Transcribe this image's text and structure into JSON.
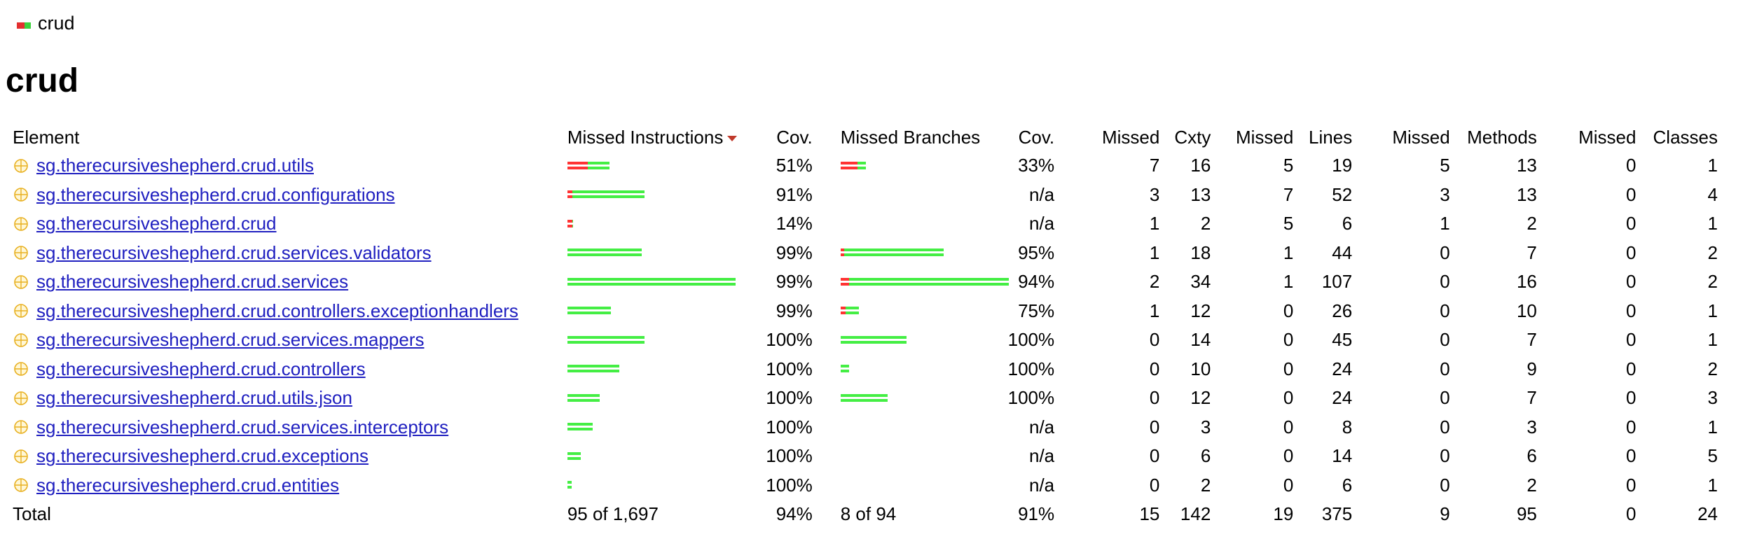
{
  "breadcrumb": {
    "label": "crud"
  },
  "page": {
    "title": "crud"
  },
  "table": {
    "headers": {
      "element": "Element",
      "missed_instructions": "Missed Instructions",
      "instr_cov": "Cov.",
      "missed_branches": "Missed Branches",
      "branch_cov": "Cov.",
      "missed_cxty": "Missed",
      "cxty": "Cxty",
      "missed_lines": "Missed",
      "lines": "Lines",
      "missed_methods": "Missed",
      "methods": "Methods",
      "missed_classes": "Missed",
      "classes": "Classes"
    },
    "rows": [
      {
        "name": "sg.therecursiveshepherd.crud.utils",
        "instr_cov": "51%",
        "branch_cov": "33%",
        "missed_cxty": "7",
        "cxty": "16",
        "missed_lines": "5",
        "lines": "19",
        "missed_methods": "5",
        "methods": "13",
        "missed_classes": "0",
        "classes": "1",
        "instr_bar": {
          "missed_fraction": 0.12,
          "covered_fraction": 0.13
        },
        "branch_bar": {
          "missed_fraction": 0.1,
          "covered_fraction": 0.05
        }
      },
      {
        "name": "sg.therecursiveshepherd.crud.configurations",
        "instr_cov": "91%",
        "branch_cov": "n/a",
        "missed_cxty": "3",
        "cxty": "13",
        "missed_lines": "7",
        "lines": "52",
        "missed_methods": "3",
        "methods": "13",
        "missed_classes": "0",
        "classes": "4",
        "instr_bar": {
          "missed_fraction": 0.03,
          "covered_fraction": 0.43
        },
        "branch_bar": null
      },
      {
        "name": "sg.therecursiveshepherd.crud",
        "instr_cov": "14%",
        "branch_cov": "n/a",
        "missed_cxty": "1",
        "cxty": "2",
        "missed_lines": "5",
        "lines": "6",
        "missed_methods": "1",
        "methods": "2",
        "missed_classes": "0",
        "classes": "1",
        "instr_bar": {
          "missed_fraction": 0.03,
          "covered_fraction": 0.005
        },
        "branch_bar": null
      },
      {
        "name": "sg.therecursiveshepherd.crud.services.validators",
        "instr_cov": "99%",
        "branch_cov": "95%",
        "missed_cxty": "1",
        "cxty": "18",
        "missed_lines": "1",
        "lines": "44",
        "missed_methods": "0",
        "methods": "7",
        "missed_classes": "0",
        "classes": "2",
        "instr_bar": {
          "missed_fraction": 0.0,
          "covered_fraction": 0.44
        },
        "branch_bar": {
          "missed_fraction": 0.02,
          "covered_fraction": 0.59
        }
      },
      {
        "name": "sg.therecursiveshepherd.crud.services",
        "instr_cov": "99%",
        "branch_cov": "94%",
        "missed_cxty": "2",
        "cxty": "34",
        "missed_lines": "1",
        "lines": "107",
        "missed_methods": "0",
        "methods": "16",
        "missed_classes": "0",
        "classes": "2",
        "instr_bar": {
          "missed_fraction": 0.0,
          "covered_fraction": 1.0
        },
        "branch_bar": {
          "missed_fraction": 0.05,
          "covered_fraction": 0.95
        }
      },
      {
        "name": "sg.therecursiveshepherd.crud.controllers.exceptionhandlers",
        "instr_cov": "99%",
        "branch_cov": "75%",
        "missed_cxty": "1",
        "cxty": "12",
        "missed_lines": "0",
        "lines": "26",
        "missed_methods": "0",
        "methods": "10",
        "missed_classes": "0",
        "classes": "1",
        "instr_bar": {
          "missed_fraction": 0.0,
          "covered_fraction": 0.26
        },
        "branch_bar": {
          "missed_fraction": 0.03,
          "covered_fraction": 0.08
        }
      },
      {
        "name": "sg.therecursiveshepherd.crud.services.mappers",
        "instr_cov": "100%",
        "branch_cov": "100%",
        "missed_cxty": "0",
        "cxty": "14",
        "missed_lines": "0",
        "lines": "45",
        "missed_methods": "0",
        "methods": "7",
        "missed_classes": "0",
        "classes": "1",
        "instr_bar": {
          "missed_fraction": 0.0,
          "covered_fraction": 0.46
        },
        "branch_bar": {
          "missed_fraction": 0.0,
          "covered_fraction": 0.39
        }
      },
      {
        "name": "sg.therecursiveshepherd.crud.controllers",
        "instr_cov": "100%",
        "branch_cov": "100%",
        "missed_cxty": "0",
        "cxty": "10",
        "missed_lines": "0",
        "lines": "24",
        "missed_methods": "0",
        "methods": "9",
        "missed_classes": "0",
        "classes": "2",
        "instr_bar": {
          "missed_fraction": 0.0,
          "covered_fraction": 0.31
        },
        "branch_bar": {
          "missed_fraction": 0.0,
          "covered_fraction": 0.05
        }
      },
      {
        "name": "sg.therecursiveshepherd.crud.utils.json",
        "instr_cov": "100%",
        "branch_cov": "100%",
        "missed_cxty": "0",
        "cxty": "12",
        "missed_lines": "0",
        "lines": "24",
        "missed_methods": "0",
        "methods": "7",
        "missed_classes": "0",
        "classes": "3",
        "instr_bar": {
          "missed_fraction": 0.0,
          "covered_fraction": 0.19
        },
        "branch_bar": {
          "missed_fraction": 0.0,
          "covered_fraction": 0.28
        }
      },
      {
        "name": "sg.therecursiveshepherd.crud.services.interceptors",
        "instr_cov": "100%",
        "branch_cov": "n/a",
        "missed_cxty": "0",
        "cxty": "3",
        "missed_lines": "0",
        "lines": "8",
        "missed_methods": "0",
        "methods": "3",
        "missed_classes": "0",
        "classes": "1",
        "instr_bar": {
          "missed_fraction": 0.0,
          "covered_fraction": 0.15
        },
        "branch_bar": null
      },
      {
        "name": "sg.therecursiveshepherd.crud.exceptions",
        "instr_cov": "100%",
        "branch_cov": "n/a",
        "missed_cxty": "0",
        "cxty": "6",
        "missed_lines": "0",
        "lines": "14",
        "missed_methods": "0",
        "methods": "6",
        "missed_classes": "0",
        "classes": "5",
        "instr_bar": {
          "missed_fraction": 0.0,
          "covered_fraction": 0.08
        },
        "branch_bar": null
      },
      {
        "name": "sg.therecursiveshepherd.crud.entities",
        "instr_cov": "100%",
        "branch_cov": "n/a",
        "missed_cxty": "0",
        "cxty": "2",
        "missed_lines": "0",
        "lines": "6",
        "missed_methods": "0",
        "methods": "2",
        "missed_classes": "0",
        "classes": "1",
        "instr_bar": {
          "missed_fraction": 0.0,
          "covered_fraction": 0.025
        },
        "branch_bar": null
      }
    ],
    "totals": {
      "label": "Total",
      "missed_instructions": "95 of 1,697",
      "instr_cov": "94%",
      "missed_branches": "8 of 94",
      "branch_cov": "91%",
      "missed_cxty": "15",
      "cxty": "142",
      "missed_lines": "19",
      "lines": "375",
      "missed_methods": "9",
      "methods": "95",
      "missed_classes": "0",
      "classes": "24"
    }
  },
  "colors": {
    "bar_missed": "#ff3333",
    "bar_covered": "#44ee44",
    "link": "#2020c0"
  },
  "icons": {
    "breadcrumb": "coverage-bar-icon",
    "package": "package-icon"
  }
}
